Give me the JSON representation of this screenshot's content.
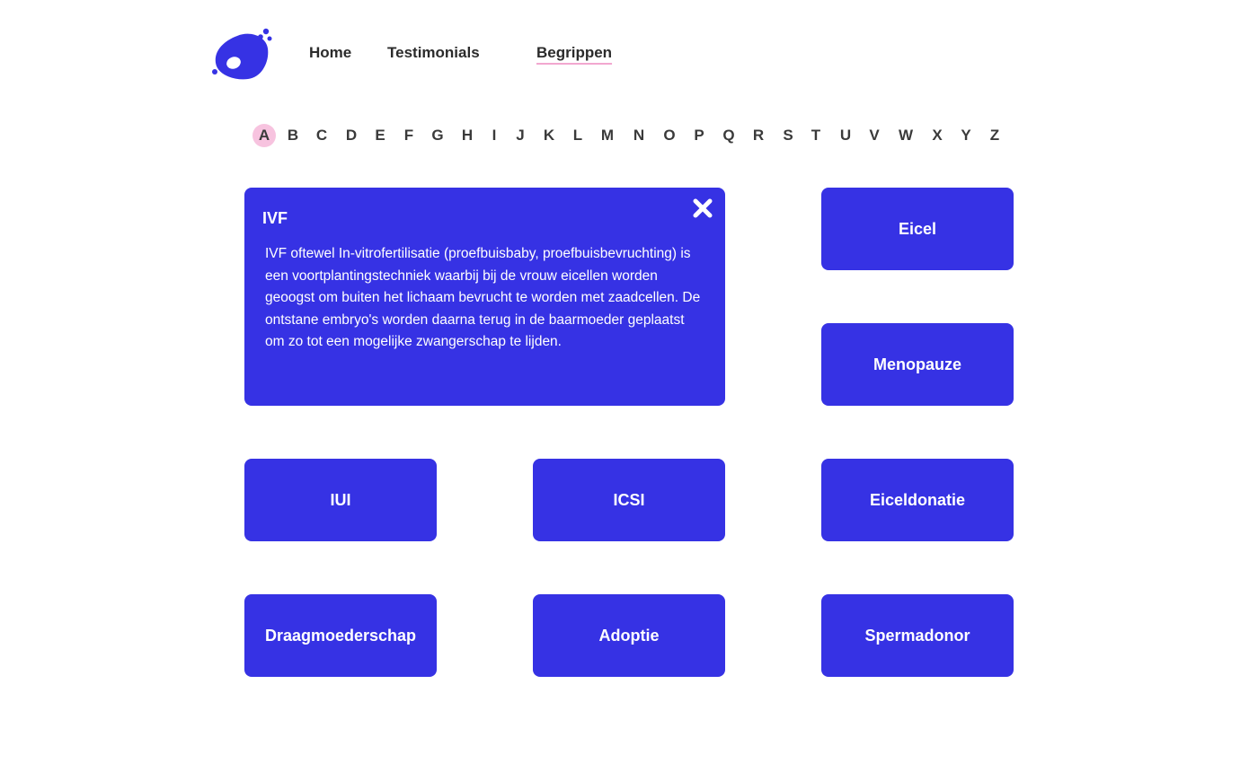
{
  "brand": {
    "logo": "blob-logo",
    "accent": "#3632e4",
    "highlight": "#f7c3df"
  },
  "nav": {
    "items": [
      {
        "label": "Home",
        "active": false
      },
      {
        "label": "Testimonials",
        "active": false
      },
      {
        "label": "Begrippen",
        "active": true
      }
    ]
  },
  "alphabet": {
    "letters": [
      "A",
      "B",
      "C",
      "D",
      "E",
      "F",
      "G",
      "H",
      "I",
      "J",
      "K",
      "L",
      "M",
      "N",
      "O",
      "P",
      "Q",
      "R",
      "S",
      "T",
      "U",
      "V",
      "W",
      "X",
      "Y",
      "Z"
    ],
    "active": "A"
  },
  "expanded_card": {
    "title": "IVF",
    "body": "IVF oftewel In-vitrofertilisatie (proefbuisbaby, proefbuisbevruchting) is een voortplantingstechniek waarbij bij de vrouw eicellen worden geoogst om buiten het lichaam bevrucht te worden met zaadcellen. De ontstane embryo's worden daarna terug in de baarmoeder geplaatst om zo tot een mogelijke zwangerschap te lijden.",
    "close_icon": "close-icon"
  },
  "cards": [
    {
      "label": "Eicel"
    },
    {
      "label": "Menopauze"
    },
    {
      "label": "IUI"
    },
    {
      "label": "ICSI"
    },
    {
      "label": "Eiceldonatie"
    },
    {
      "label": "Draagmoederschap"
    },
    {
      "label": "Adoptie"
    },
    {
      "label": "Spermadonor"
    }
  ]
}
